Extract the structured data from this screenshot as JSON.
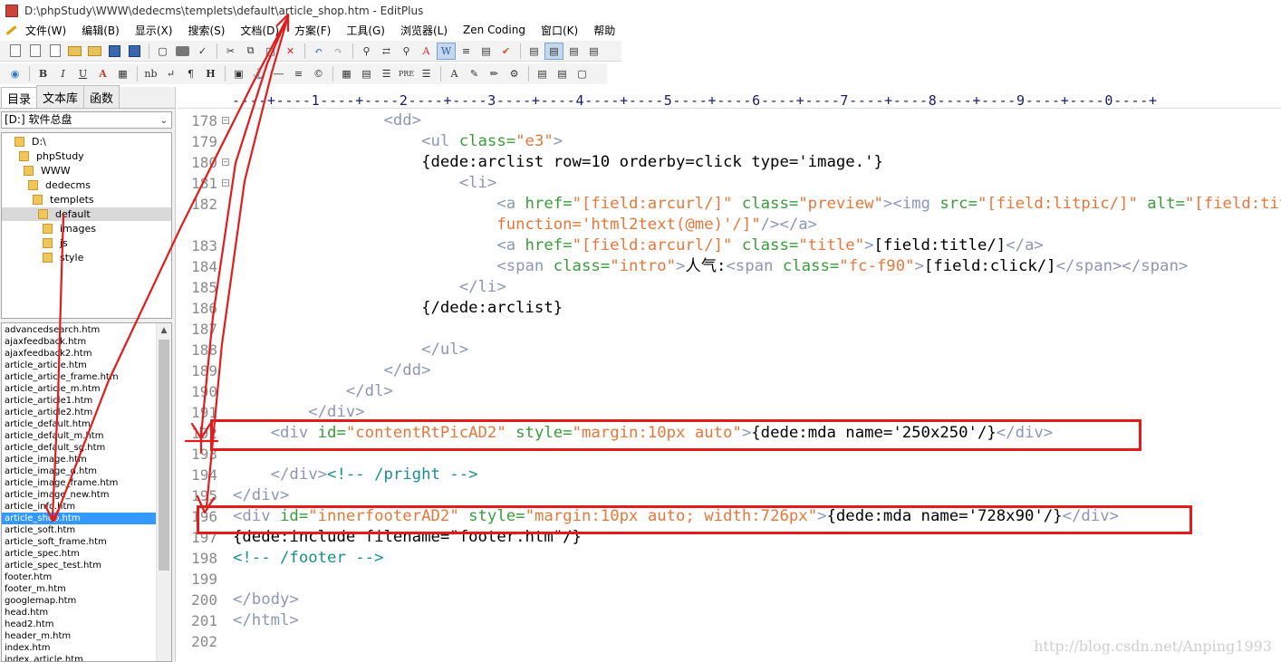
{
  "window": {
    "title": "D:\\phpStudy\\WWW\\dedecms\\templets\\default\\article_shop.htm - EditPlus"
  },
  "menu": [
    "文件(W)",
    "编辑(B)",
    "显示(X)",
    "搜索(S)",
    "文档(D)",
    "方案(F)",
    "工具(G)",
    "浏览器(L)",
    "Zen Coding",
    "窗口(K)",
    "帮助"
  ],
  "toolbar2": {
    "bold": "B",
    "italic": "I",
    "underline": "U",
    "font_color": "A",
    "nbsp": "nb",
    "para": "¶",
    "heading": "H",
    "pre": "PRE"
  },
  "sidebar": {
    "tabs": [
      "目录",
      "文本库",
      "函数"
    ],
    "drive": "[D:] 软件总盘",
    "tree": [
      "D:\\",
      "phpStudy",
      "WWW",
      "dedecms",
      "templets",
      "default",
      "images",
      "js",
      "style"
    ],
    "files": [
      "advancedsearch.htm",
      "ajaxfeedback.htm",
      "ajaxfeedback2.htm",
      "article_article.htm",
      "article_article_frame.htm",
      "article_article_m.htm",
      "article_article1.htm",
      "article_article2.htm",
      "article_default.htm",
      "article_default_m.htm",
      "article_default_sg.htm",
      "article_image.htm",
      "article_image_d.htm",
      "article_image_frame.htm",
      "article_image_new.htm",
      "article_info.htm",
      "article_shop.htm",
      "article_soft.htm",
      "article_soft_frame.htm",
      "article_spec.htm",
      "article_spec_test.htm",
      "footer.htm",
      "footer_m.htm",
      "googlemap.htm",
      "head.htm",
      "head2.htm",
      "header_m.htm",
      "index.htm",
      "index_article.htm"
    ],
    "selected_file": "article_shop.htm"
  },
  "ruler": "----+----1----+----2----+----3----+----4----+----5----+----6----+----7----+----8----+----9----+----0----+",
  "line_numbers": [
    "178",
    "179",
    "180",
    "181",
    "182",
    "",
    "183",
    "184",
    "185",
    "186",
    "187",
    "188",
    "189",
    "190",
    "191",
    "192",
    "193",
    "194",
    "195",
    "196",
    "197",
    "198",
    "199",
    "200",
    "201",
    "202"
  ],
  "code": [
    [
      [
        "t",
        "                <dd>"
      ]
    ],
    [
      [
        "t",
        "                    <ul "
      ],
      [
        "a",
        "class="
      ],
      [
        "s",
        "\"e3\""
      ],
      [
        "t",
        ">"
      ]
    ],
    [
      [
        "k",
        "                    {dede:arclist row=10 orderby=click type='image.'}"
      ]
    ],
    [
      [
        "t",
        "                        <li>"
      ]
    ],
    [
      [
        "t",
        "                            <a "
      ],
      [
        "a",
        "href="
      ],
      [
        "s",
        "\"[field:arcurl/]\""
      ],
      [
        "t",
        " "
      ],
      [
        "a",
        "class="
      ],
      [
        "s",
        "\"preview\""
      ],
      [
        "t",
        "><img "
      ],
      [
        "a",
        "src="
      ],
      [
        "s",
        "\"[field:litpic/]\""
      ],
      [
        "t",
        " "
      ],
      [
        "a",
        "alt="
      ],
      [
        "s",
        "\"[field:title/]\""
      ]
    ],
    [
      [
        "s",
        "                            function='html2text(@me)'/]\""
      ],
      [
        "t",
        "/></a>"
      ]
    ],
    [
      [
        "t",
        "                            <a "
      ],
      [
        "a",
        "href="
      ],
      [
        "s",
        "\"[field:arcurl/]\""
      ],
      [
        "t",
        " "
      ],
      [
        "a",
        "class="
      ],
      [
        "s",
        "\"title\""
      ],
      [
        "t",
        ">"
      ],
      [
        "k",
        "[field:title/]"
      ],
      [
        "t",
        "</a>"
      ]
    ],
    [
      [
        "t",
        "                            <span "
      ],
      [
        "a",
        "class="
      ],
      [
        "s",
        "\"intro\""
      ],
      [
        "t",
        ">"
      ],
      [
        "k",
        "人气:"
      ],
      [
        "t",
        "<span "
      ],
      [
        "a",
        "class="
      ],
      [
        "s",
        "\"fc-f90\""
      ],
      [
        "t",
        ">"
      ],
      [
        "k",
        "[field:click/]"
      ],
      [
        "t",
        "</span></span>"
      ]
    ],
    [
      [
        "t",
        "                        </li>"
      ]
    ],
    [
      [
        "k",
        "                    {/dede:arclist}"
      ]
    ],
    [
      [
        "k",
        ""
      ]
    ],
    [
      [
        "t",
        "                    </ul>"
      ]
    ],
    [
      [
        "t",
        "                </dd>"
      ]
    ],
    [
      [
        "t",
        "            </dl>"
      ]
    ],
    [
      [
        "t",
        "        </div>"
      ]
    ],
    [
      [
        "t",
        "    <div "
      ],
      [
        "a",
        "id="
      ],
      [
        "s",
        "\"contentRtPicAD2\""
      ],
      [
        "t",
        " "
      ],
      [
        "a",
        "style="
      ],
      [
        "s",
        "\"margin:10px auto\""
      ],
      [
        "t",
        ">"
      ],
      [
        "k",
        "{dede:mda name='250x250'/}"
      ],
      [
        "t",
        "</div>"
      ]
    ],
    [
      [
        "k",
        ""
      ]
    ],
    [
      [
        "t",
        "    </div>"
      ],
      [
        "c",
        "<!-- /pright -->"
      ]
    ],
    [
      [
        "t",
        "</div>"
      ]
    ],
    [
      [
        "t",
        "<div "
      ],
      [
        "a",
        "id="
      ],
      [
        "s",
        "\"innerfooterAD2\""
      ],
      [
        "t",
        " "
      ],
      [
        "a",
        "style="
      ],
      [
        "s",
        "\"margin:10px auto; width:726px\""
      ],
      [
        "t",
        ">"
      ],
      [
        "k",
        "{dede:mda name='728x90'/}"
      ],
      [
        "t",
        "</div>"
      ]
    ],
    [
      [
        "k",
        "{dede:include filename=\"footer.htm\"/}"
      ]
    ],
    [
      [
        "c",
        "<!-- /footer -->"
      ]
    ],
    [
      [
        "k",
        ""
      ]
    ],
    [
      [
        "t",
        "</body>"
      ]
    ],
    [
      [
        "t",
        "</html>"
      ]
    ],
    [
      [
        "k",
        ""
      ]
    ]
  ],
  "watermark": "http://blog.csdn.net/Anping1993",
  "colors": {
    "annotation_red": "#e21b1b",
    "selection_blue": "#3399ff",
    "tag": "#8b96b8",
    "attribute": "#3a9b3a",
    "string": "#e6773a",
    "comment": "#1c8c8c"
  }
}
